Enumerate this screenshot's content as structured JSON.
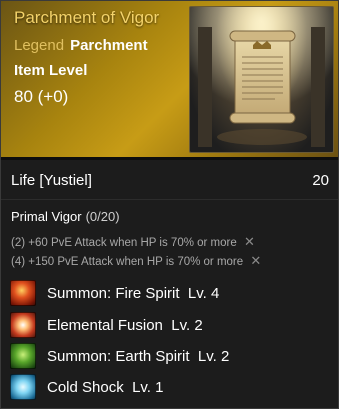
{
  "item": {
    "name": "Parchment of Vigor",
    "grade": "Legend",
    "type": "Parchment",
    "item_level_label": "Item Level",
    "item_level_value": "80 (+0)",
    "image_icon": "scroll-parchment-icon"
  },
  "stats": {
    "life_label": "Life [Yustiel]",
    "life_value": "20"
  },
  "set": {
    "title": "Primal Vigor",
    "count": "(0/20)",
    "bonuses": [
      {
        "tier": "(2)",
        "text": "+60 PvE Attack when HP is 70% or more",
        "status_icon": "x-mark-icon"
      },
      {
        "tier": "(4)",
        "text": "+150 PvE Attack when HP is 70% or more",
        "status_icon": "x-mark-icon"
      }
    ]
  },
  "skills": [
    {
      "name": "Summon: Fire Spirit",
      "level": "Lv. 4",
      "icon": "fire-spirit-icon"
    },
    {
      "name": "Elemental Fusion",
      "level": "Lv. 2",
      "icon": "elemental-fusion-icon"
    },
    {
      "name": "Summon: Earth Spirit",
      "level": "Lv. 2",
      "icon": "earth-spirit-icon"
    },
    {
      "name": "Cold Shock",
      "level": "Lv. 1",
      "icon": "cold-shock-icon"
    }
  ],
  "colors": {
    "header_gold": "#c79c16",
    "item_name": "#f4d36a",
    "background": "#1c1c1c"
  }
}
